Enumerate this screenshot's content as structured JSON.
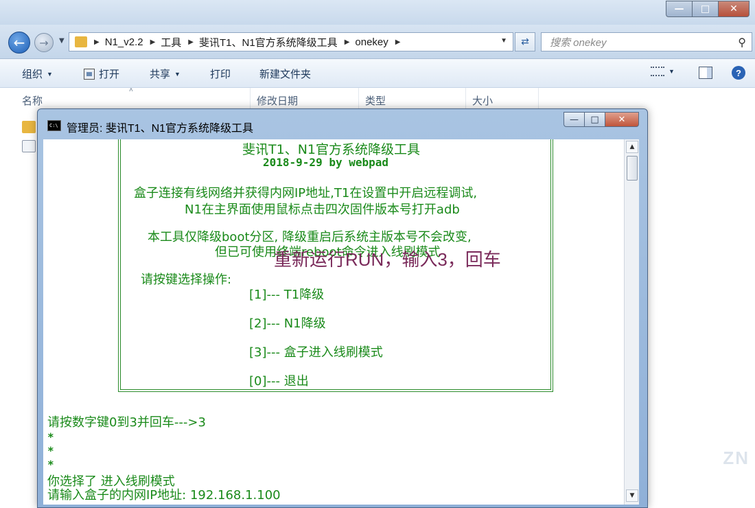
{
  "explorer": {
    "caption": {
      "min": "—",
      "max": "□",
      "close": "✕"
    },
    "breadcrumb": [
      "N1_v2.2",
      "工具",
      "斐讯T1、N1官方系统降级工具",
      "onekey"
    ],
    "search_placeholder": "搜索 onekey",
    "toolbar": {
      "organize": "组织",
      "open": "打开",
      "share": "共享",
      "print": "打印",
      "new_folder": "新建文件夹"
    },
    "columns": {
      "name": "名称",
      "date": "修改日期",
      "type": "类型",
      "size": "大小"
    }
  },
  "console_window": {
    "title": "管理员: 斐讯T1、N1官方系统降级工具",
    "caption": {
      "min": "—",
      "max": "□",
      "close": "✕"
    },
    "lines": {
      "header_title": "斐讯T1、N1官方系统降级工具",
      "header_date": "2018-9-29  by webpad",
      "info1": "盒子连接有线网络并获得内网IP地址,T1在设置中开启远程调试,",
      "info2": "N1在主界面使用鼠标点击四次固件版本号打开adb",
      "note1": "本工具仅降级boot分区, 降级重启后系统主版本号不会改变,",
      "note2": "但已可使用终端reboot命令进入线刷模式",
      "prompt": "请按键选择操作:",
      "opt1": "[1]--- T1降级",
      "opt2": "[2]--- N1降级",
      "opt3": "[3]--- 盒子进入线刷模式",
      "opt0": "[0]--- 退出",
      "input_prompt": "请按数字键0到3并回车--->3",
      "star1": "*",
      "star2": "*",
      "star3": "*",
      "chosen": "你选择了 进入线刷模式",
      "ip_prompt": "请输入盒子的内网IP地址: 192.168.1.100"
    },
    "overlay_note": "重新运行RUN，输入3，回车"
  },
  "watermark": "ZN"
}
